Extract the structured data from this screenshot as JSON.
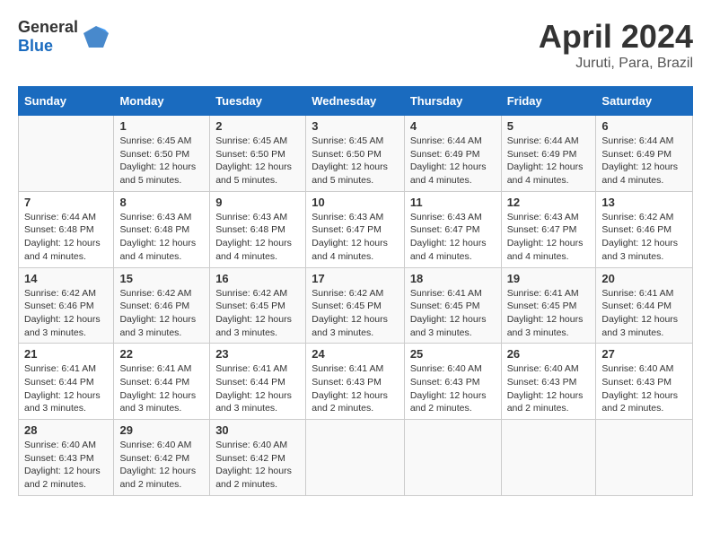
{
  "header": {
    "logo_general": "General",
    "logo_blue": "Blue",
    "title": "April 2024",
    "subtitle": "Juruti, Para, Brazil"
  },
  "calendar": {
    "days_of_week": [
      "Sunday",
      "Monday",
      "Tuesday",
      "Wednesday",
      "Thursday",
      "Friday",
      "Saturday"
    ],
    "weeks": [
      [
        {
          "day": "",
          "info": ""
        },
        {
          "day": "1",
          "info": "Sunrise: 6:45 AM\nSunset: 6:50 PM\nDaylight: 12 hours\nand 5 minutes."
        },
        {
          "day": "2",
          "info": "Sunrise: 6:45 AM\nSunset: 6:50 PM\nDaylight: 12 hours\nand 5 minutes."
        },
        {
          "day": "3",
          "info": "Sunrise: 6:45 AM\nSunset: 6:50 PM\nDaylight: 12 hours\nand 5 minutes."
        },
        {
          "day": "4",
          "info": "Sunrise: 6:44 AM\nSunset: 6:49 PM\nDaylight: 12 hours\nand 4 minutes."
        },
        {
          "day": "5",
          "info": "Sunrise: 6:44 AM\nSunset: 6:49 PM\nDaylight: 12 hours\nand 4 minutes."
        },
        {
          "day": "6",
          "info": "Sunrise: 6:44 AM\nSunset: 6:49 PM\nDaylight: 12 hours\nand 4 minutes."
        }
      ],
      [
        {
          "day": "7",
          "info": "Sunrise: 6:44 AM\nSunset: 6:48 PM\nDaylight: 12 hours\nand 4 minutes."
        },
        {
          "day": "8",
          "info": "Sunrise: 6:43 AM\nSunset: 6:48 PM\nDaylight: 12 hours\nand 4 minutes."
        },
        {
          "day": "9",
          "info": "Sunrise: 6:43 AM\nSunset: 6:48 PM\nDaylight: 12 hours\nand 4 minutes."
        },
        {
          "day": "10",
          "info": "Sunrise: 6:43 AM\nSunset: 6:47 PM\nDaylight: 12 hours\nand 4 minutes."
        },
        {
          "day": "11",
          "info": "Sunrise: 6:43 AM\nSunset: 6:47 PM\nDaylight: 12 hours\nand 4 minutes."
        },
        {
          "day": "12",
          "info": "Sunrise: 6:43 AM\nSunset: 6:47 PM\nDaylight: 12 hours\nand 4 minutes."
        },
        {
          "day": "13",
          "info": "Sunrise: 6:42 AM\nSunset: 6:46 PM\nDaylight: 12 hours\nand 3 minutes."
        }
      ],
      [
        {
          "day": "14",
          "info": "Sunrise: 6:42 AM\nSunset: 6:46 PM\nDaylight: 12 hours\nand 3 minutes."
        },
        {
          "day": "15",
          "info": "Sunrise: 6:42 AM\nSunset: 6:46 PM\nDaylight: 12 hours\nand 3 minutes."
        },
        {
          "day": "16",
          "info": "Sunrise: 6:42 AM\nSunset: 6:45 PM\nDaylight: 12 hours\nand 3 minutes."
        },
        {
          "day": "17",
          "info": "Sunrise: 6:42 AM\nSunset: 6:45 PM\nDaylight: 12 hours\nand 3 minutes."
        },
        {
          "day": "18",
          "info": "Sunrise: 6:41 AM\nSunset: 6:45 PM\nDaylight: 12 hours\nand 3 minutes."
        },
        {
          "day": "19",
          "info": "Sunrise: 6:41 AM\nSunset: 6:45 PM\nDaylight: 12 hours\nand 3 minutes."
        },
        {
          "day": "20",
          "info": "Sunrise: 6:41 AM\nSunset: 6:44 PM\nDaylight: 12 hours\nand 3 minutes."
        }
      ],
      [
        {
          "day": "21",
          "info": "Sunrise: 6:41 AM\nSunset: 6:44 PM\nDaylight: 12 hours\nand 3 minutes."
        },
        {
          "day": "22",
          "info": "Sunrise: 6:41 AM\nSunset: 6:44 PM\nDaylight: 12 hours\nand 3 minutes."
        },
        {
          "day": "23",
          "info": "Sunrise: 6:41 AM\nSunset: 6:44 PM\nDaylight: 12 hours\nand 3 minutes."
        },
        {
          "day": "24",
          "info": "Sunrise: 6:41 AM\nSunset: 6:43 PM\nDaylight: 12 hours\nand 2 minutes."
        },
        {
          "day": "25",
          "info": "Sunrise: 6:40 AM\nSunset: 6:43 PM\nDaylight: 12 hours\nand 2 minutes."
        },
        {
          "day": "26",
          "info": "Sunrise: 6:40 AM\nSunset: 6:43 PM\nDaylight: 12 hours\nand 2 minutes."
        },
        {
          "day": "27",
          "info": "Sunrise: 6:40 AM\nSunset: 6:43 PM\nDaylight: 12 hours\nand 2 minutes."
        }
      ],
      [
        {
          "day": "28",
          "info": "Sunrise: 6:40 AM\nSunset: 6:43 PM\nDaylight: 12 hours\nand 2 minutes."
        },
        {
          "day": "29",
          "info": "Sunrise: 6:40 AM\nSunset: 6:42 PM\nDaylight: 12 hours\nand 2 minutes."
        },
        {
          "day": "30",
          "info": "Sunrise: 6:40 AM\nSunset: 6:42 PM\nDaylight: 12 hours\nand 2 minutes."
        },
        {
          "day": "",
          "info": ""
        },
        {
          "day": "",
          "info": ""
        },
        {
          "day": "",
          "info": ""
        },
        {
          "day": "",
          "info": ""
        }
      ]
    ]
  }
}
